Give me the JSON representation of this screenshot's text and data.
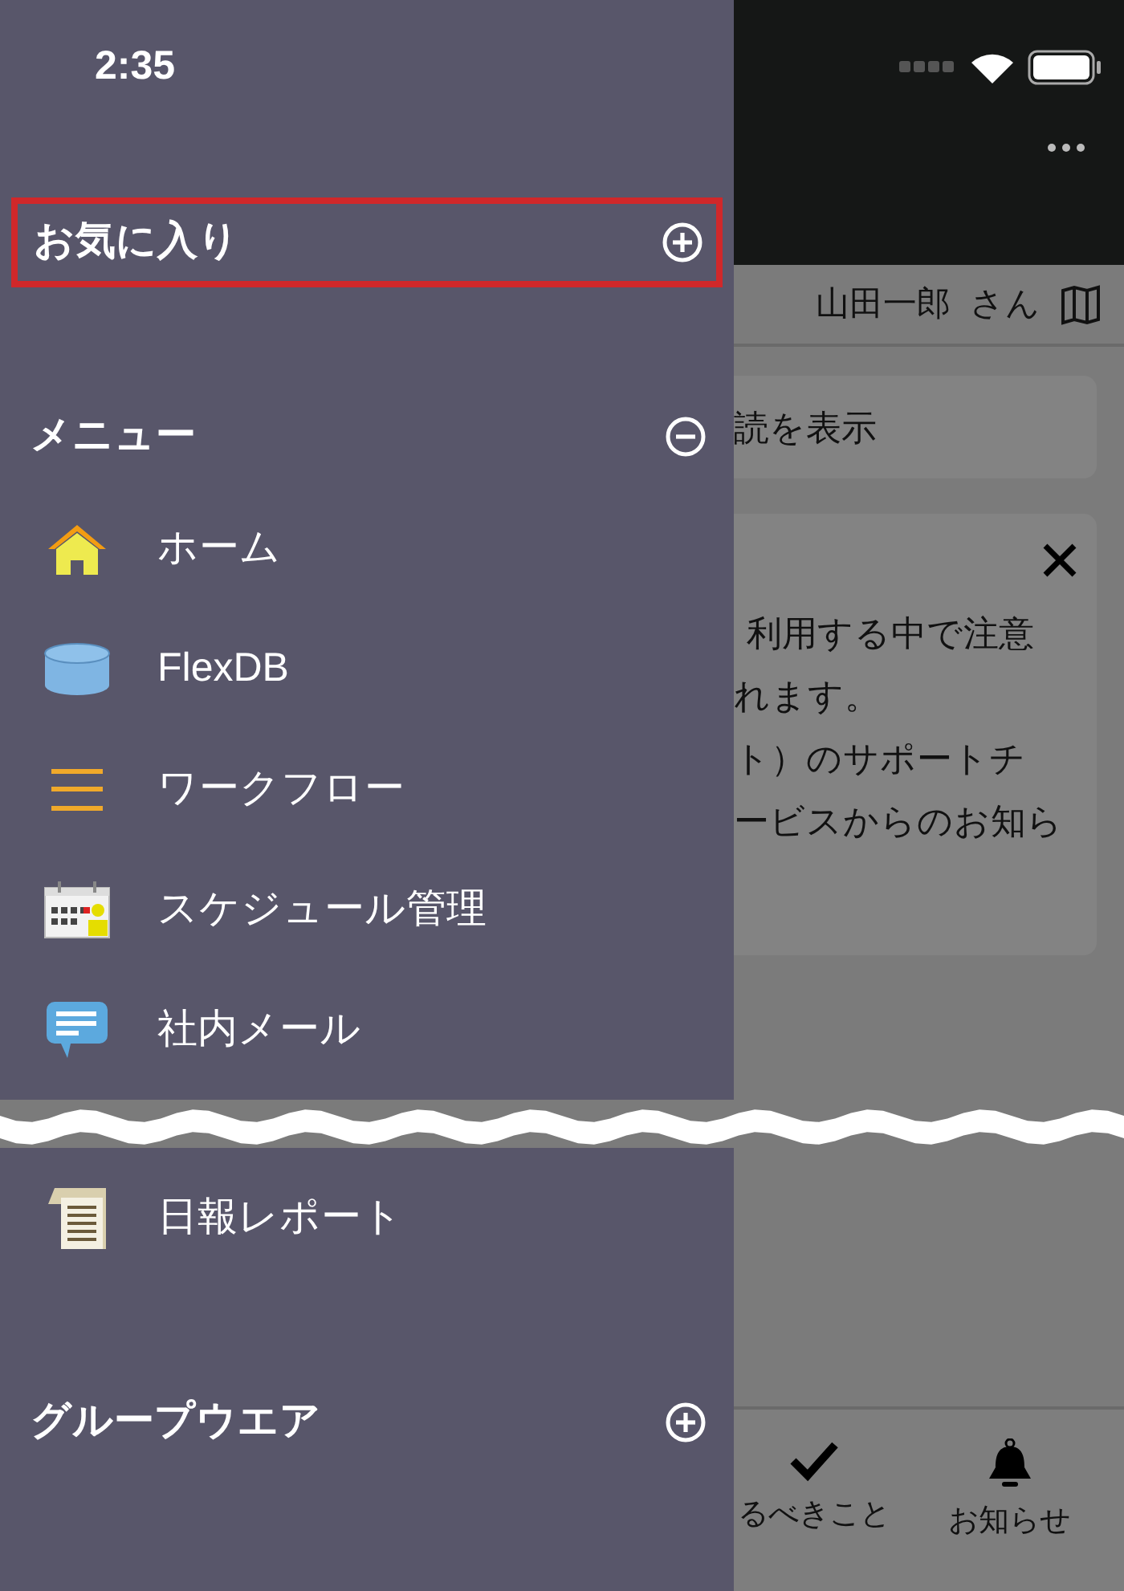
{
  "status_bar": {
    "time": "2:35"
  },
  "drawer": {
    "favorites": {
      "title": "お気に入り",
      "expanded": false,
      "highlighted": true
    },
    "menu": {
      "title": "メニュー",
      "expanded": true,
      "items": [
        {
          "label": "ホーム"
        },
        {
          "label": "FlexDB"
        },
        {
          "label": "ワークフロー"
        },
        {
          "label": "スケジュール管理"
        },
        {
          "label": "社内メール"
        }
      ],
      "items_after_break": [
        {
          "label": "日報レポート"
        }
      ]
    },
    "groupware": {
      "title": "グループウエア",
      "expanded": false
    }
  },
  "background": {
    "user_bar": {
      "name": "山田一郎",
      "suffix": "さん"
    },
    "link_card": {
      "text": "読を表示"
    },
    "notice_card": {
      "lines": [
        "利用する中で注意",
        "れます。",
        "ト）のサポートチ",
        "ービスからのお知ら"
      ]
    },
    "bottom_nav": [
      {
        "label": "るべきこと"
      },
      {
        "label": "お知らせ"
      }
    ]
  }
}
